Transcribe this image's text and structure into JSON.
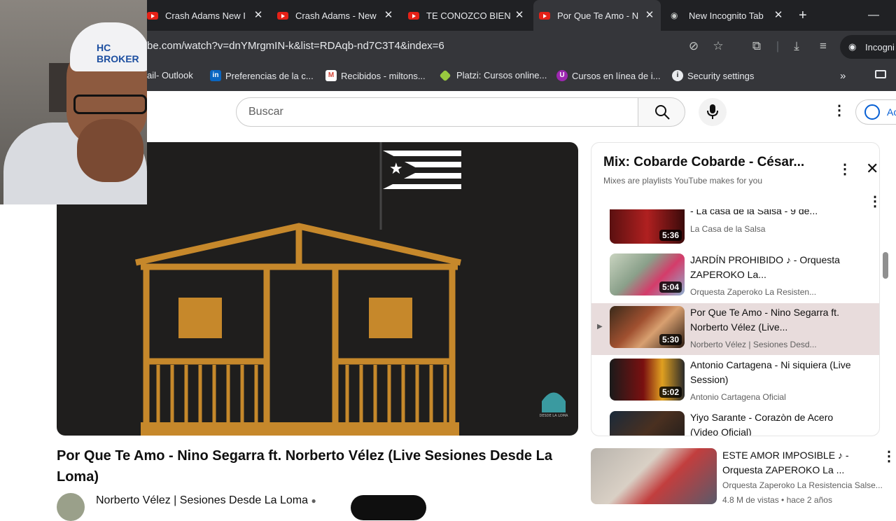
{
  "browser": {
    "tabs": [
      {
        "title": "Crash Adams New I"
      },
      {
        "title": "Crash Adams - New"
      },
      {
        "title": "TE CONOZCO BIEN"
      },
      {
        "title": "Por Que Te Amo - N"
      },
      {
        "title": "New Incognito Tab"
      }
    ],
    "url": "be.com/watch?v=dnYMrgmIN-k&list=RDAqb-nd7C3T4&index=6",
    "incognito_label": "Incogni",
    "bookmarks": [
      {
        "label": "ail- Outlook",
        "color": "#0078d4"
      },
      {
        "label": "Preferencias de la c...",
        "color": "#0a66c2"
      },
      {
        "label": "Recibidos - miltons...",
        "color": "#d44638"
      },
      {
        "label": "Platzi: Cursos online...",
        "color": "#98ca3f"
      },
      {
        "label": "Cursos en línea de i...",
        "color": "#9c27b0"
      },
      {
        "label": "Security settings",
        "color": "#e8eaed"
      }
    ]
  },
  "youtube": {
    "search_placeholder": "Buscar",
    "signin_label": "Ac",
    "video": {
      "title": "Por Que Te Amo - Nino Segarra ft. Norberto Vélez (Live Sesiones Desde La Loma)",
      "channel": "Norberto Vélez | Sesiones Desde La Loma",
      "watermark": "DESDE LA LOMA"
    },
    "playlist": {
      "title": "Mix: Cobarde Cobarde - César...",
      "subtitle": "Mixes are playlists YouTube makes for you",
      "items": [
        {
          "title": "- La casa de la Salsa - 9 de...",
          "channel": "La Casa de la Salsa",
          "duration": "5:36"
        },
        {
          "title": "JARDÍN PROHIBIDO ♪ - Orquesta ZAPEROKO La...",
          "channel": "Orquesta Zaperoko La Resisten...",
          "duration": "5:04"
        },
        {
          "title": "Por Que Te Amo - Nino Segarra ft. Norberto Vélez (Live...",
          "channel": "Norberto Vélez | Sesiones Desd...",
          "duration": "5:30"
        },
        {
          "title": "Antonio Cartagena - Ni siquiera (Live Session)",
          "channel": "Antonio Cartagena Oficial",
          "duration": "5:02"
        },
        {
          "title": "Yiyo Sarante - Corazòn de Acero (Video Oficial)",
          "channel": "",
          "duration": ""
        }
      ]
    },
    "recommendation": {
      "title": "ESTE AMOR IMPOSIBLE ♪ - Orquesta ZAPEROKO La ...",
      "channel": "Orquesta Zaperoko La Resistencia Salse...",
      "meta": "4.8 M de vistas • hace 2 años"
    }
  },
  "colors": {
    "accent": "#e52117",
    "orange": "#c6882b"
  }
}
